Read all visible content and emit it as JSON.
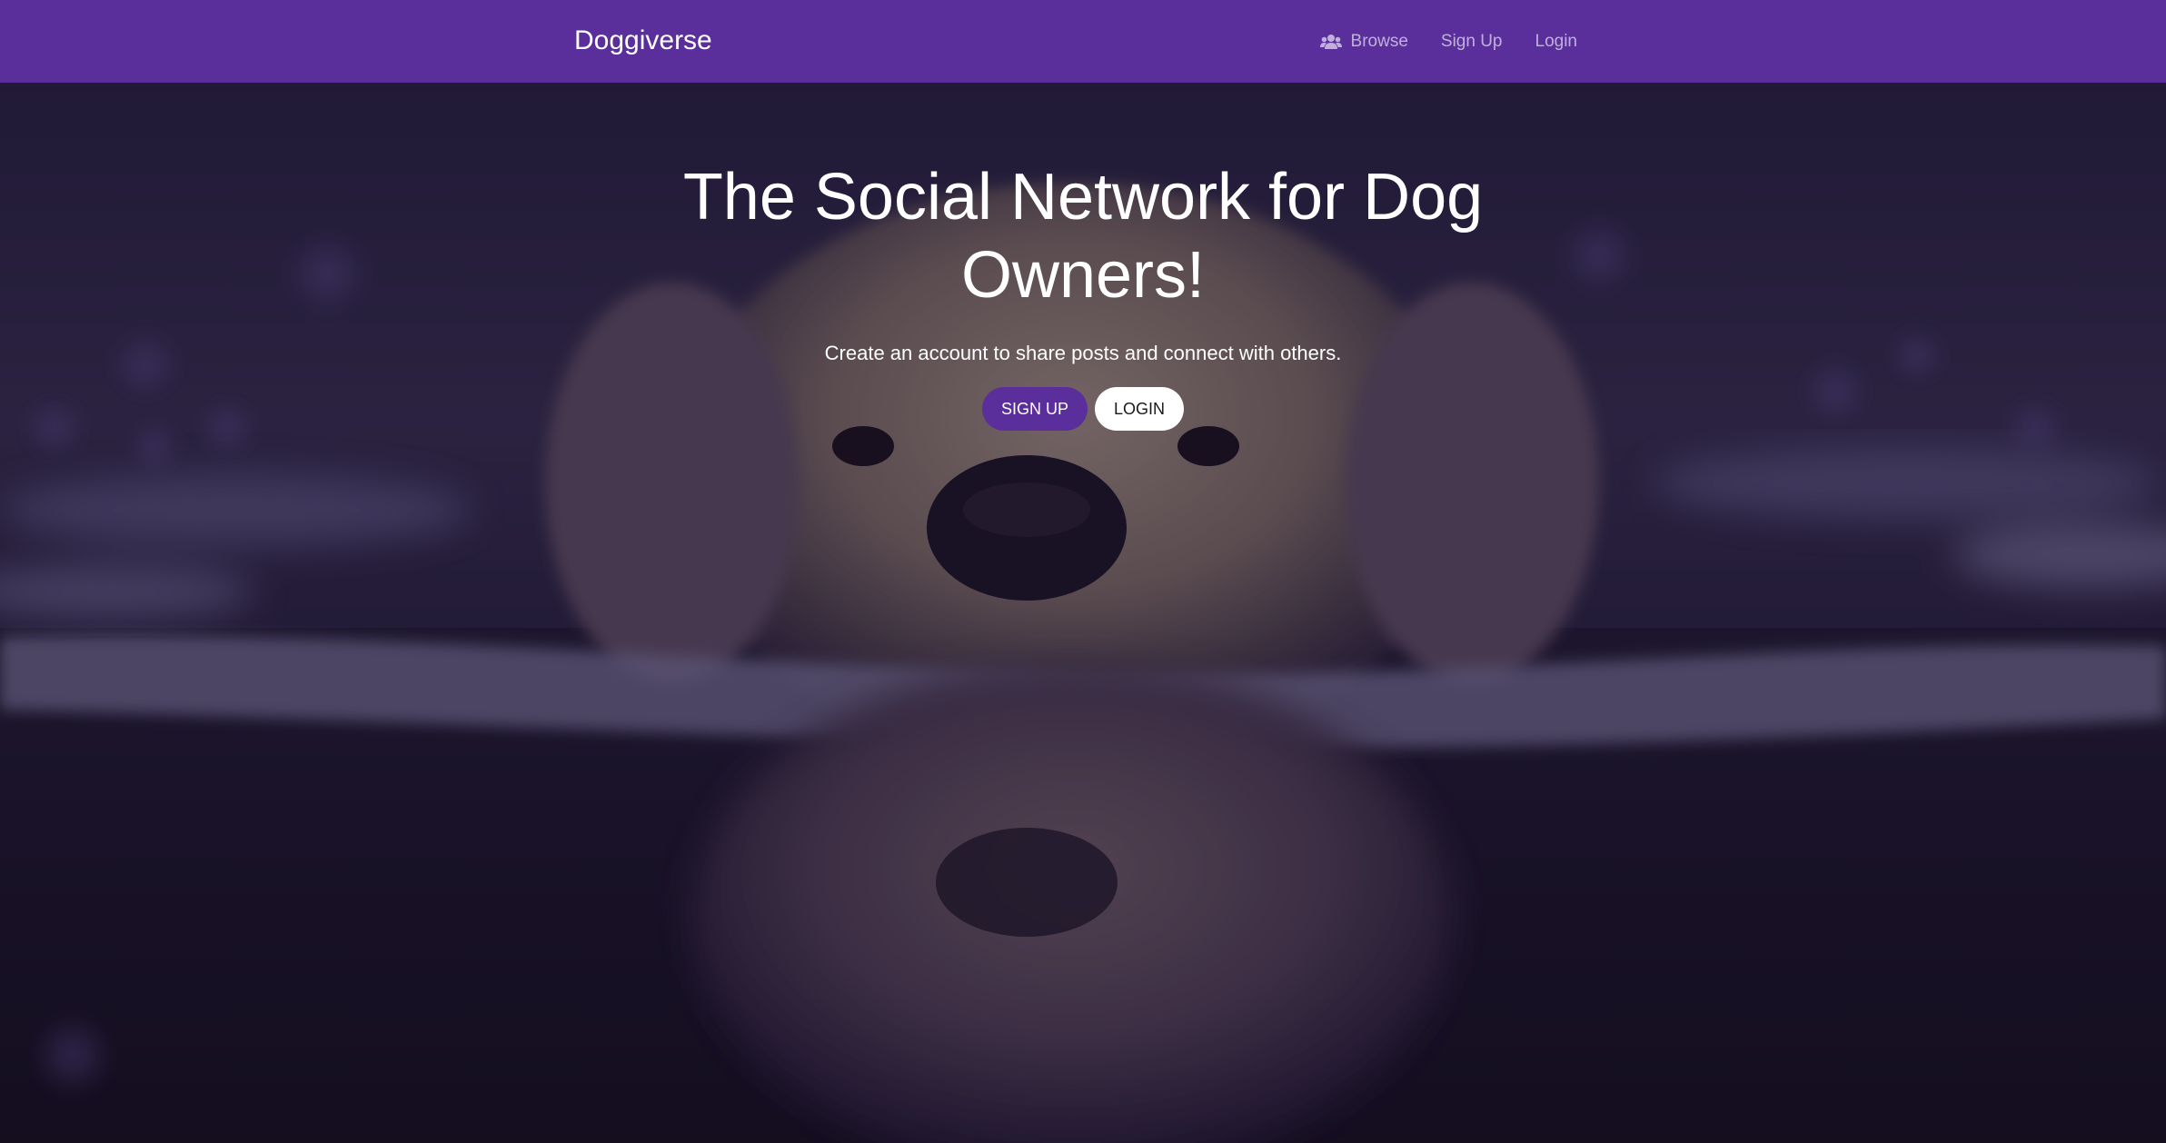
{
  "navbar": {
    "brand": "Doggiverse",
    "links": [
      {
        "label": "Browse",
        "icon": "users-icon"
      },
      {
        "label": "Sign Up"
      },
      {
        "label": "Login"
      }
    ]
  },
  "hero": {
    "title": "The Social Network for Dog Owners!",
    "subtitle": "Create an account to share posts and connect with others.",
    "primary_button": "SIGN UP",
    "secondary_button": "LOGIN",
    "background_image": "golden retriever swimming in water with reflection"
  },
  "colors": {
    "brand_purple": "#5a2f9c",
    "nav_text_muted": "rgba(255,255,255,0.62)",
    "white": "#ffffff"
  }
}
